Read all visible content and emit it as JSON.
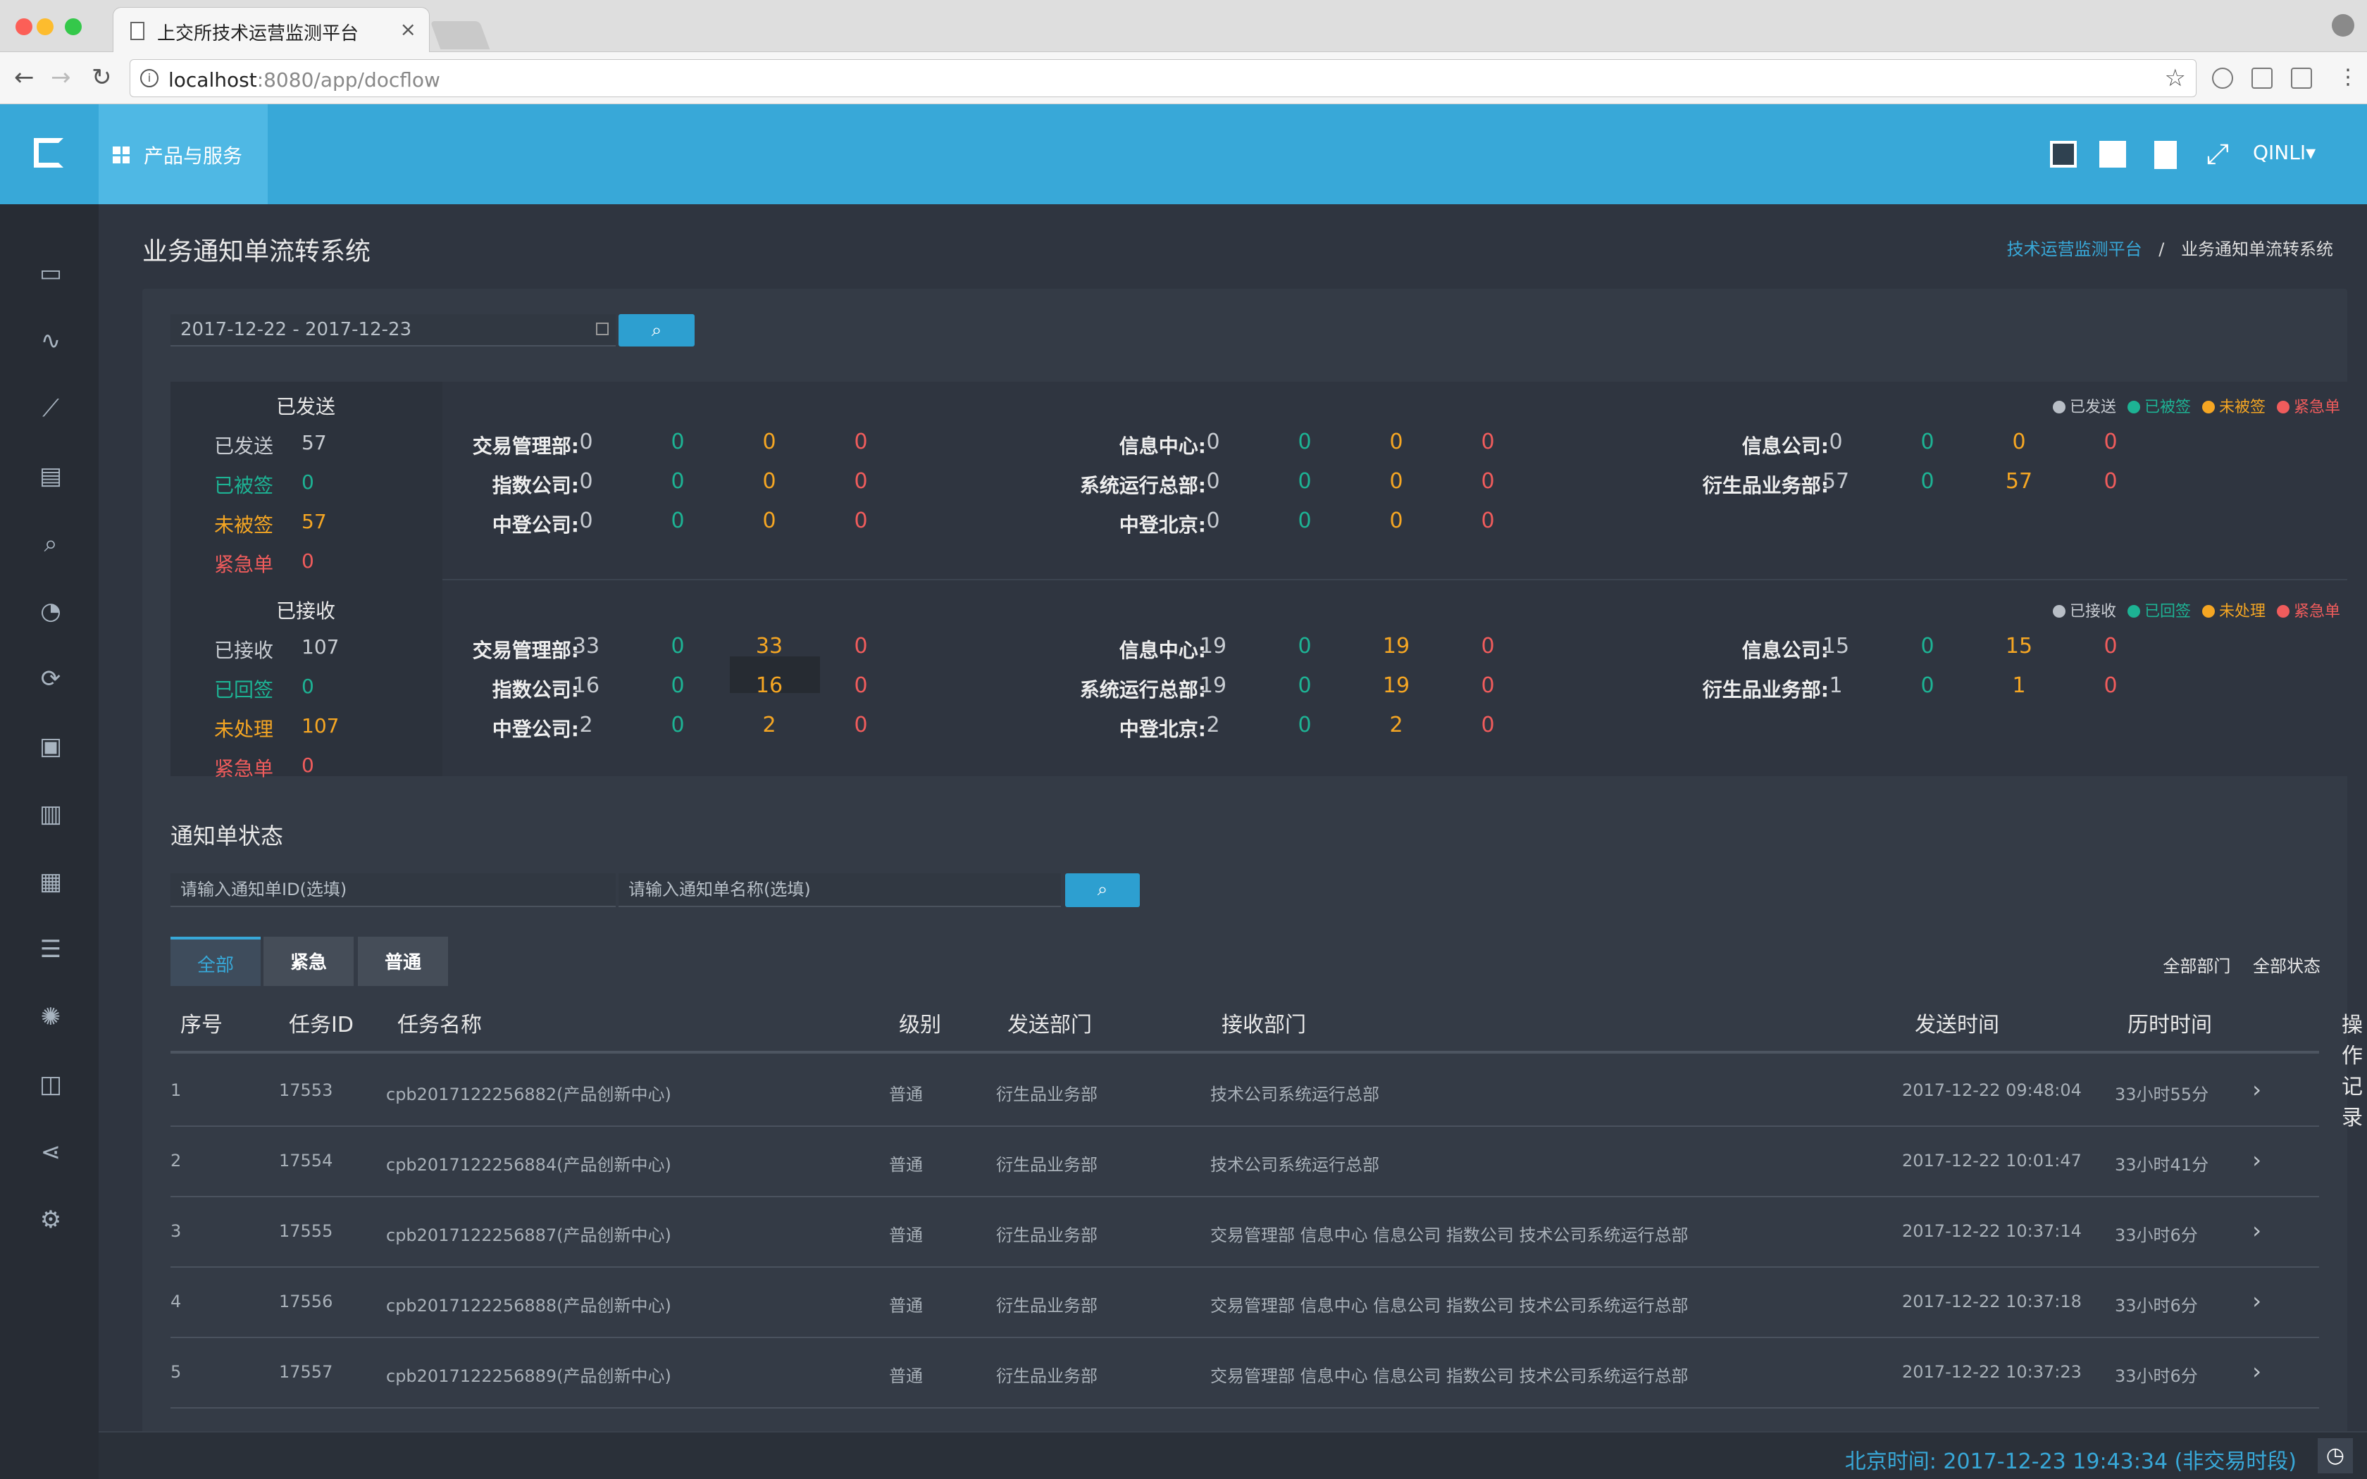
{
  "browser": {
    "tab_title": "上交所技术运营监测平台",
    "tab_close": "×",
    "url_host": "localhost",
    "url_path": ":8080/app/docflow",
    "back": "←",
    "forward": "→",
    "reload": "↻",
    "info": "i",
    "star": "☆"
  },
  "header": {
    "products_label": "产品与服务",
    "user": "QINLI▾",
    "expand_icon": "⤢"
  },
  "page": {
    "title": "业务通知单流转系统",
    "breadcrumb_root": "技术运营监测平台",
    "breadcrumb_sep": "/",
    "breadcrumb_current": "业务通知单流转系统"
  },
  "filter": {
    "date_range": "2017-12-22 - 2017-12-23",
    "search_icon": "⌕"
  },
  "sent": {
    "header": "已发送",
    "summary": [
      {
        "label": "已发送",
        "value": "57"
      },
      {
        "label": "已被签",
        "value": "0"
      },
      {
        "label": "未被签",
        "value": "57"
      },
      {
        "label": "紧急单",
        "value": "0"
      }
    ],
    "legend": [
      "已发送",
      "已被签",
      "未被签",
      "紧急单"
    ],
    "depts": [
      {
        "name": "交易管理部:",
        "vals": [
          "0",
          "0",
          "0",
          "0"
        ]
      },
      {
        "name": "指数公司:",
        "vals": [
          "0",
          "0",
          "0",
          "0"
        ]
      },
      {
        "name": "中登公司:",
        "vals": [
          "0",
          "0",
          "0",
          "0"
        ]
      },
      {
        "name": "信息中心:",
        "vals": [
          "0",
          "0",
          "0",
          "0"
        ]
      },
      {
        "name": "系统运行总部:",
        "vals": [
          "0",
          "0",
          "0",
          "0"
        ]
      },
      {
        "name": "中登北京:",
        "vals": [
          "0",
          "0",
          "0",
          "0"
        ]
      },
      {
        "name": "信息公司:",
        "vals": [
          "0",
          "0",
          "0",
          "0"
        ]
      },
      {
        "name": "衍生品业务部:",
        "vals": [
          "57",
          "0",
          "57",
          "0"
        ]
      }
    ]
  },
  "received": {
    "header": "已接收",
    "summary": [
      {
        "label": "已接收",
        "value": "107"
      },
      {
        "label": "已回签",
        "value": "0"
      },
      {
        "label": "未处理",
        "value": "107"
      },
      {
        "label": "紧急单",
        "value": "0"
      }
    ],
    "legend": [
      "已接收",
      "已回签",
      "未处理",
      "紧急单"
    ],
    "depts": [
      {
        "name": "交易管理部:",
        "vals": [
          "33",
          "0",
          "33",
          "0"
        ]
      },
      {
        "name": "指数公司:",
        "vals": [
          "16",
          "0",
          "16",
          "0"
        ]
      },
      {
        "name": "中登公司:",
        "vals": [
          "2",
          "0",
          "2",
          "0"
        ]
      },
      {
        "name": "信息中心:",
        "vals": [
          "19",
          "0",
          "19",
          "0"
        ]
      },
      {
        "name": "系统运行总部:",
        "vals": [
          "19",
          "0",
          "19",
          "0"
        ]
      },
      {
        "name": "中登北京:",
        "vals": [
          "2",
          "0",
          "2",
          "0"
        ]
      },
      {
        "name": "信息公司:",
        "vals": [
          "15",
          "0",
          "15",
          "0"
        ]
      },
      {
        "name": "衍生品业务部:",
        "vals": [
          "1",
          "0",
          "1",
          "0"
        ]
      }
    ]
  },
  "status": {
    "title": "通知单状态",
    "id_placeholder": "请输入通知单ID(选填)",
    "name_placeholder": "请输入通知单名称(选填)",
    "tabs": [
      "全部",
      "紧急",
      "普通"
    ],
    "dept_filter": "全部部门",
    "state_filter": "全部状态",
    "columns": [
      "序号",
      "任务ID",
      "任务名称",
      "级别",
      "发送部门",
      "接收部门",
      "发送时间",
      "历时时间",
      "操作记录"
    ],
    "rows": [
      {
        "no": "1",
        "id": "17553",
        "name": "cpb2017122256882(产品创新中心)",
        "level": "普通",
        "from": "衍生品业务部",
        "to": "技术公司系统运行总部",
        "time": "2017-12-22 09:48:04",
        "dur": "33小时55分"
      },
      {
        "no": "2",
        "id": "17554",
        "name": "cpb2017122256884(产品创新中心)",
        "level": "普通",
        "from": "衍生品业务部",
        "to": "技术公司系统运行总部",
        "time": "2017-12-22 10:01:47",
        "dur": "33小时41分"
      },
      {
        "no": "3",
        "id": "17555",
        "name": "cpb2017122256887(产品创新中心)",
        "level": "普通",
        "from": "衍生品业务部",
        "to": "交易管理部  信息中心  信息公司  指数公司  技术公司系统运行总部",
        "time": "2017-12-22 10:37:14",
        "dur": "33小时6分"
      },
      {
        "no": "4",
        "id": "17556",
        "name": "cpb2017122256888(产品创新中心)",
        "level": "普通",
        "from": "衍生品业务部",
        "to": "交易管理部  信息中心  信息公司  指数公司  技术公司系统运行总部",
        "time": "2017-12-22 10:37:18",
        "dur": "33小时6分"
      },
      {
        "no": "5",
        "id": "17557",
        "name": "cpb2017122256889(产品创新中心)",
        "level": "普通",
        "from": "衍生品业务部",
        "to": "交易管理部  信息中心  信息公司  指数公司  技术公司系统运行总部",
        "time": "2017-12-22 10:37:23",
        "dur": "33小时6分"
      }
    ]
  },
  "footer": {
    "time": "北京时间: 2017-12-23 19:43:34 (非交易时段)",
    "clock_icon": "◷"
  },
  "colors": {
    "accent": "#38a8d8",
    "teal": "#1db394",
    "orange": "#f5a623",
    "red": "#f05c5c",
    "gray": "#c8ccd2"
  },
  "sidebar_icons": [
    "monitor-icon",
    "pulse-icon",
    "trend-chart-icon",
    "calendar-note-icon",
    "search-report-icon",
    "pie-chart-icon",
    "refresh-globe-icon",
    "cash-register-icon",
    "server-icon",
    "calendar-plus-icon",
    "storage-icon",
    "network-hub-icon",
    "clipboard-time-icon",
    "share-icon",
    "settings-cog-icon"
  ]
}
